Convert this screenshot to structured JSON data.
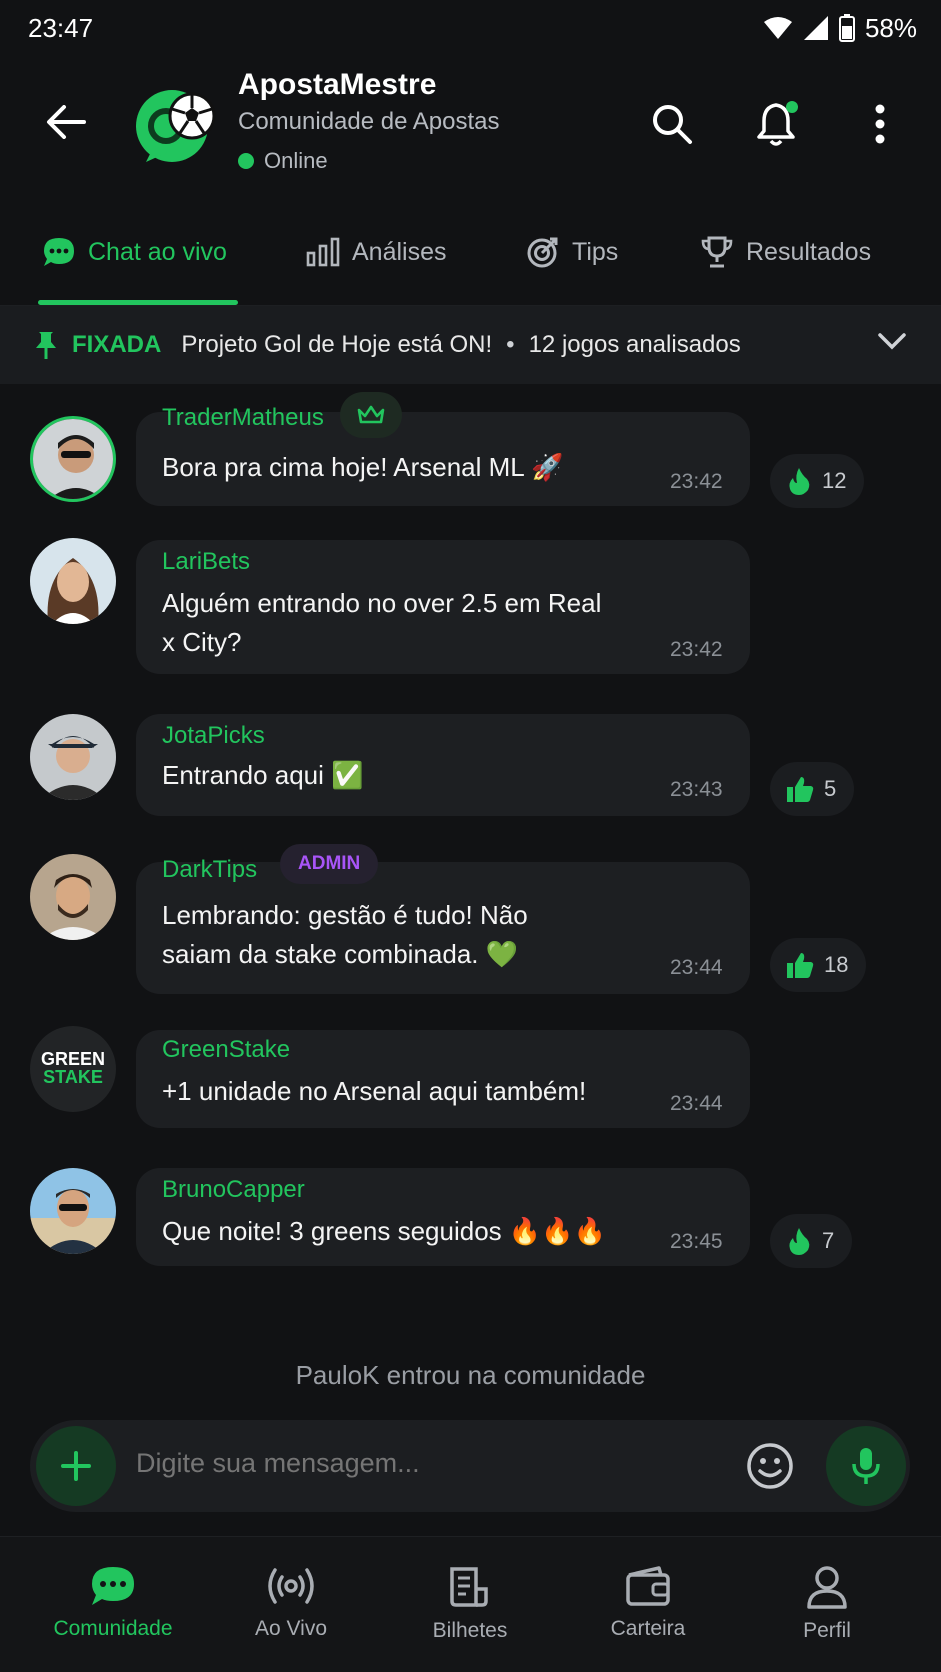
{
  "status_bar": {
    "time": "23:47",
    "battery": "58%"
  },
  "header": {
    "title": "ApostaMestre",
    "subtitle": "Comunidade de Apostas",
    "status": "Online"
  },
  "tabs": [
    {
      "label": "Chat ao vivo",
      "icon": "chat-bubble-icon",
      "active": true
    },
    {
      "label": "Análises",
      "icon": "bar-chart-icon",
      "active": false
    },
    {
      "label": "Tips",
      "icon": "target-icon",
      "active": false
    },
    {
      "label": "Resultados",
      "icon": "trophy-icon",
      "active": false
    }
  ],
  "pinned": {
    "label": "FIXADA",
    "text": "Projeto Gol de Hoje está ON!",
    "extra": "12 jogos analisados"
  },
  "messages": [
    {
      "name": "TraderMatheus",
      "badge": "crown",
      "text": "Bora pra cima hoje! Arsenal ML 🚀",
      "time": "23:42",
      "reaction": {
        "icon": "fire-icon",
        "count": "12"
      }
    },
    {
      "name": "LariBets",
      "text": "Alguém entrando no over 2.5 em Real x City?",
      "time": "23:42"
    },
    {
      "name": "JotaPicks",
      "text": "Entrando aqui ✅",
      "time": "23:43",
      "reaction": {
        "icon": "thumbs-up-icon",
        "count": "5"
      }
    },
    {
      "name": "DarkTips",
      "badge": "ADMIN",
      "text": "Lembrando: gestão é tudo! Não saiam da stake combinada. 💚",
      "time": "23:44",
      "reaction": {
        "icon": "thumbs-up-icon",
        "count": "18"
      }
    },
    {
      "name": "GreenStake",
      "avatar_text": [
        "GREEN",
        "STAKE"
      ],
      "text": "+1 unidade no Arsenal aqui também!",
      "time": "23:44"
    },
    {
      "name": "BrunoCapper",
      "text": "Que noite! 3 greens seguidos 🔥🔥🔥",
      "time": "23:45",
      "reaction": {
        "icon": "fire-icon",
        "count": "7"
      }
    }
  ],
  "system_message": "PauloK entrou na comunidade",
  "composer": {
    "placeholder": "Digite sua mensagem..."
  },
  "bottom_nav": [
    {
      "label": "Comunidade",
      "icon": "chat-bubble-icon",
      "active": true
    },
    {
      "label": "Ao Vivo",
      "icon": "broadcast-icon",
      "active": false
    },
    {
      "label": "Bilhetes",
      "icon": "ticket-icon",
      "active": false
    },
    {
      "label": "Carteira",
      "icon": "wallet-icon",
      "active": false
    },
    {
      "label": "Perfil",
      "icon": "user-icon",
      "active": false
    }
  ],
  "colors": {
    "accent": "#22c55e",
    "background": "#111214",
    "bubble": "#1d1f22",
    "admin": "#a855f7"
  }
}
